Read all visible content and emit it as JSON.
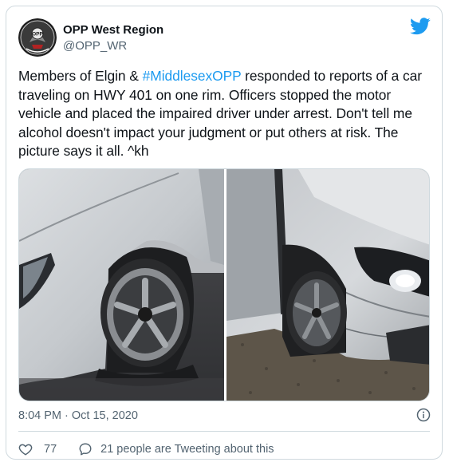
{
  "tweet": {
    "author_name": "OPP West Region",
    "author_handle": "@OPP_WR",
    "text_part1": "Members of Elgin & ",
    "hashtag": "#MiddlesexOPP",
    "text_part2": " responded to reports of a car traveling on HWY 401 on one rim. Officers stopped the motor vehicle and placed the impaired driver under arrest. Don't tell me alcohol doesn't impact your judgment or put others at risk. The picture says it all. ^kh",
    "timestamp": "8:04 PM · Oct 15, 2020",
    "like_count": "77",
    "talk_label": "21 people are Tweeting about this",
    "logo_text": "OPP"
  },
  "colors": {
    "accent": "#1d9bf0",
    "secondary_text": "#536471",
    "like_icon": "#536471",
    "border": "#cfd9de"
  },
  "icons": {
    "brand": "twitter-bird-icon",
    "info": "info-icon",
    "like": "heart-icon",
    "talk": "speech-bubble-icon"
  }
}
